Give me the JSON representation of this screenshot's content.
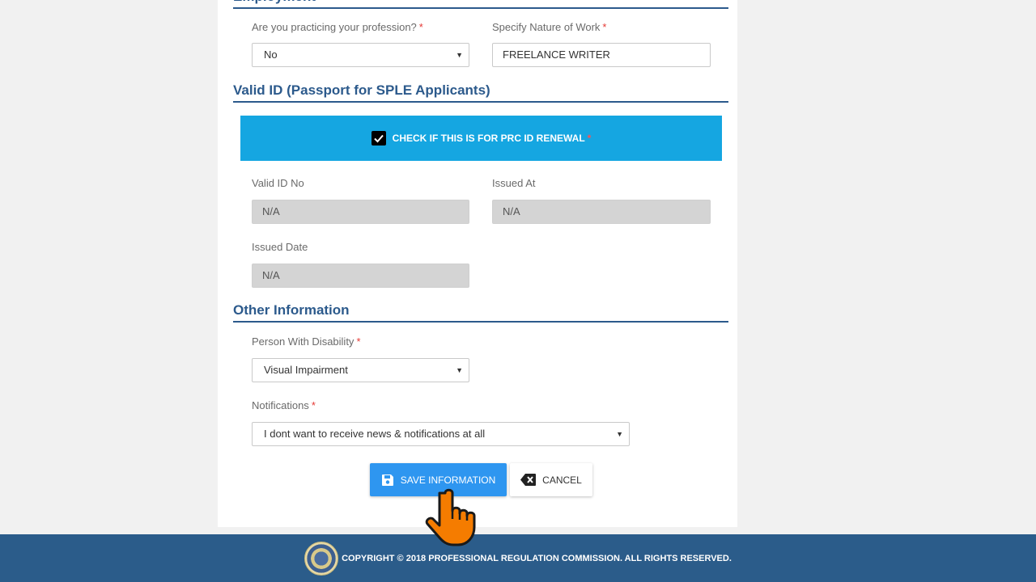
{
  "sections": {
    "employment": "Employment",
    "valid_id": "Valid ID (Passport for SPLE Applicants)",
    "other_info": "Other Information"
  },
  "employment": {
    "practicing_label": "Are you practicing your profession?",
    "practicing_value": "No",
    "nature_label": "Specify Nature of Work",
    "nature_value": "FREELANCE WRITER"
  },
  "valid_id": {
    "renewal_label": "CHECK IF THIS IS FOR PRC ID RENEWAL",
    "renewal_checked": true,
    "id_no_label": "Valid ID No",
    "id_no_value": "N/A",
    "issued_at_label": "Issued At",
    "issued_at_value": "N/A",
    "issued_date_label": "Issued Date",
    "issued_date_value": "N/A"
  },
  "other_info": {
    "pwd_label": "Person With Disability",
    "pwd_value": "Visual Impairment",
    "notif_label": "Notifications",
    "notif_value": "I dont want to receive news & notifications at all"
  },
  "required_mark": "*",
  "buttons": {
    "save": "SAVE INFORMATION",
    "cancel": "CANCEL"
  },
  "footer": {
    "copyright": "COPYRIGHT © 2018 PROFESSIONAL REGULATION COMMISSION. ALL RIGHTS RESERVED."
  },
  "icons": {
    "save": "floppy-disk-icon",
    "cancel": "backspace-x-icon",
    "check": "checkmark-icon",
    "cursor": "pointing-hand-cursor-icon",
    "logo": "prc-seal-logo"
  },
  "colors": {
    "section_title": "#2c5a8c",
    "banner": "#15a6e1",
    "save_button": "#2e96f0",
    "footer": "#2b5c8a",
    "required": "#e53935",
    "cursor": "#f57c00"
  }
}
